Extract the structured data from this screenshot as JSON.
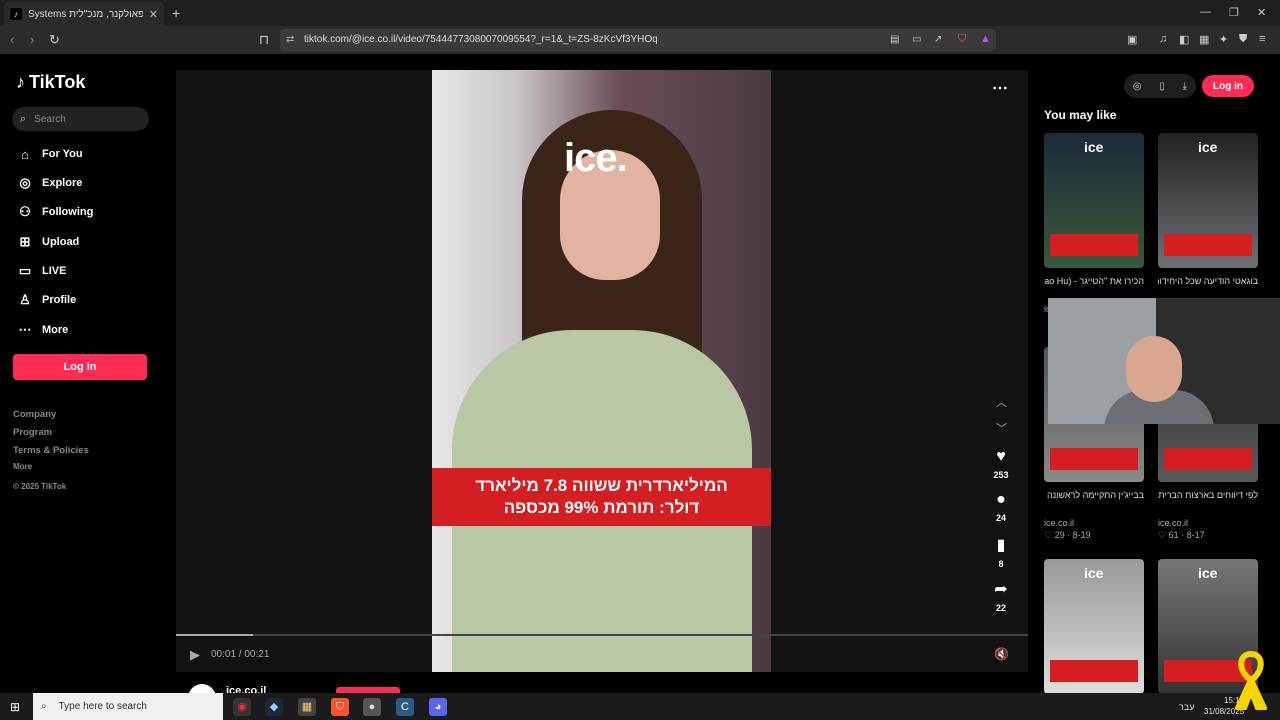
{
  "browser": {
    "tab_title": "Systems גיוני פאולקנר, מנכ\"לית",
    "new_tab": "+",
    "url": "tiktok.com/@ice.co.il/video/7544477308007009554?_r=1&_t=ZS-8zKcVf3YHOq",
    "minimize": "—",
    "maximize": "❐",
    "close": "✕"
  },
  "sidebar": {
    "logo": "TikTok",
    "search_placeholder": "Search",
    "nav": [
      {
        "label": "For You",
        "icon": "home-icon"
      },
      {
        "label": "Explore",
        "icon": "compass-icon"
      },
      {
        "label": "Following",
        "icon": "person-icon"
      },
      {
        "label": "Upload",
        "icon": "plus-square-icon"
      },
      {
        "label": "LIVE",
        "icon": "tv-icon"
      },
      {
        "label": "Profile",
        "icon": "profile-icon"
      },
      {
        "label": "More",
        "icon": "more-dots-icon"
      }
    ],
    "login": "Log in",
    "footer": [
      "Company",
      "Program",
      "Terms & Policies",
      "More",
      "© 2025 TikTok"
    ]
  },
  "video": {
    "brand": "ice.",
    "banner_line1": "המיליארדרית ששווה 7.8 מיליארד",
    "banner_line2": "דולר: תורמת 99% מכספה",
    "likes": "253",
    "comments": "24",
    "saves": "8",
    "shares": "22",
    "time": "00:01 / 00:21",
    "progress": 0.09,
    "author": "ice.co.il"
  },
  "right_panel": {
    "login": "Log in",
    "heading": "You may like",
    "cards": [
      {
        "caption": "הכירו את \"הטייגר - (Xiao Hu)\" הקוו...",
        "source": "ice",
        "meta": ""
      },
      {
        "caption": "בוגאטי הודיעה שכל היחידות של דגמי...",
        "source": "",
        "meta": ""
      },
      {
        "caption": "בבייג'ין התקיימה לראשונה אולימפיאדת...",
        "source": "ice.co.il",
        "meta": "♡ 29 · 8-19"
      },
      {
        "caption": "לפי דיווחים בארצות הברית, בשעות האחרונות...",
        "source": "ice.co.il",
        "meta": "♡ 61 · 8-17"
      },
      {
        "caption": "",
        "source": "",
        "meta": ""
      },
      {
        "caption": "",
        "source": "",
        "meta": ""
      }
    ]
  },
  "taskbar": {
    "search_placeholder": "Type here to search",
    "lang": "עבר",
    "time": "15:19",
    "date": "31/08/2025"
  },
  "colors": {
    "accent": "#fe2c55",
    "banner_red": "#d51e22",
    "background": "#000000"
  }
}
